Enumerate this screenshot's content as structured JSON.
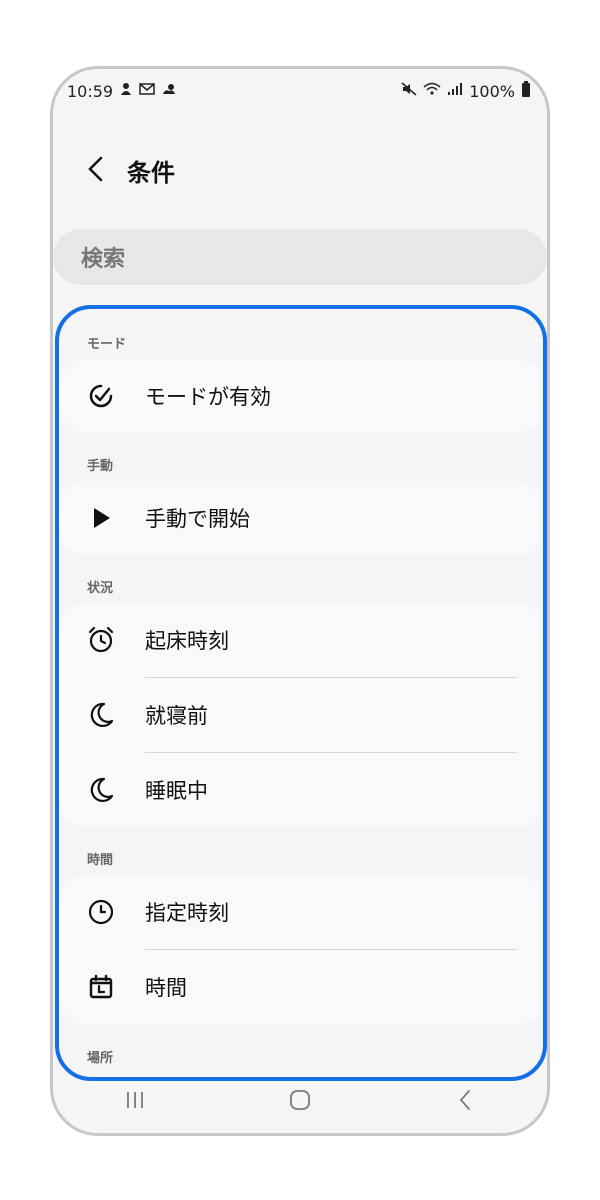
{
  "status_bar": {
    "time": "10:59",
    "battery": "100%",
    "left_icons": [
      "person-icon",
      "mail-icon",
      "weather-icon"
    ],
    "right_icons": [
      "mute-icon",
      "wifi-icon",
      "signal-icon",
      "battery-icon"
    ]
  },
  "header": {
    "back_icon": "chevron-left-icon",
    "title": "条件"
  },
  "search": {
    "placeholder": "検索"
  },
  "sections": [
    {
      "label": "モード",
      "items": [
        {
          "icon": "check-circle-icon",
          "label": "モードが有効"
        }
      ]
    },
    {
      "label": "手動",
      "items": [
        {
          "icon": "play-icon",
          "label": "手動で開始"
        }
      ]
    },
    {
      "label": "状況",
      "items": [
        {
          "icon": "alarm-clock-icon",
          "label": "起床時刻"
        },
        {
          "icon": "moon-icon",
          "label": "就寝前"
        },
        {
          "icon": "moon-icon",
          "label": "睡眠中"
        }
      ]
    },
    {
      "label": "時間",
      "items": [
        {
          "icon": "clock-icon",
          "label": "指定時刻"
        },
        {
          "icon": "calendar-clock-icon",
          "label": "時間"
        }
      ]
    },
    {
      "label": "場所",
      "items": []
    }
  ],
  "nav_bar": {
    "recents": "|||",
    "home": "○",
    "back": "‹"
  },
  "colors": {
    "accent_highlight": "#1670e5",
    "background": "#f5f5f5",
    "card": "#f9f9f9",
    "search_bg": "#e7e7e7"
  }
}
